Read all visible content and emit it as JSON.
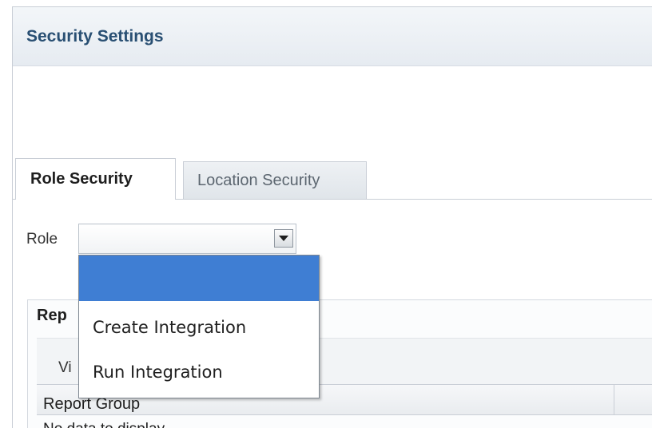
{
  "header": {
    "title": "Security Settings"
  },
  "tabs": [
    {
      "label": "Role Security",
      "selected": true
    },
    {
      "label": "Location Security",
      "selected": false
    }
  ],
  "role_field": {
    "label": "Role",
    "value": "",
    "options": [
      "",
      "Create Integration",
      "Run Integration"
    ],
    "highlighted_option": ""
  },
  "panel": {
    "title_partial": "Rep",
    "view_label_partial": "Vi",
    "table": {
      "columns": [
        "Report Group"
      ],
      "first_row_partial": "No data to display"
    }
  },
  "colors": {
    "title": "#294f73",
    "highlight": "#3f7ed3",
    "border": "#c9ced6"
  }
}
